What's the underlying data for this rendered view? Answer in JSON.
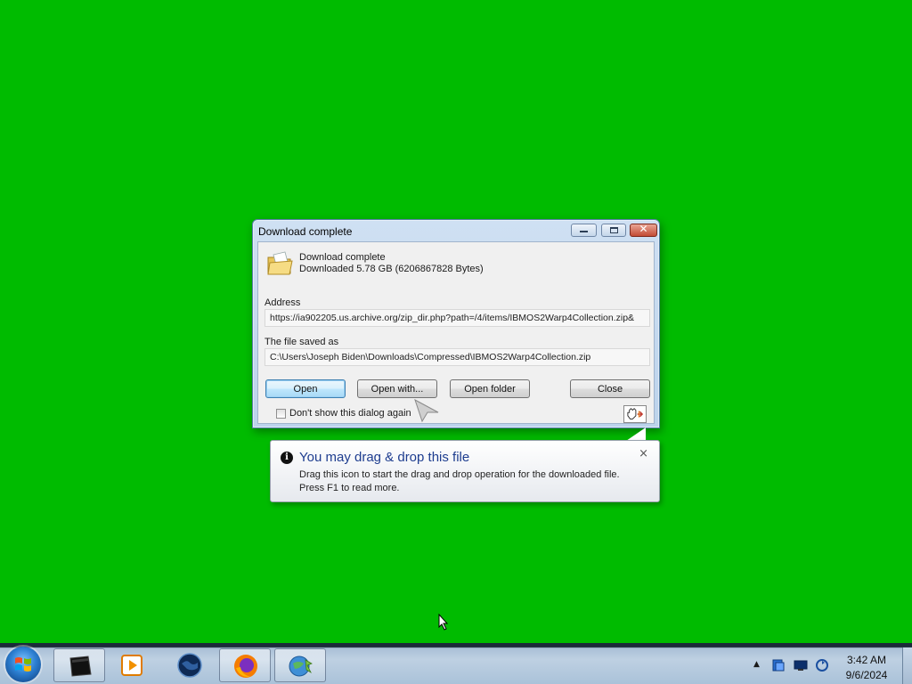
{
  "colors": {
    "desktop_background": "#00bb00",
    "balloon_title": "#1e3d8f"
  },
  "dialog": {
    "title": "Download complete",
    "status_line1": "Download complete",
    "status_line2": "Downloaded  5.78  GB (6206867828 Bytes)",
    "address_label": "Address",
    "address_value": "https://ia902205.us.archive.org/zip_dir.php?path=/4/items/IBMOS2Warp4Collection.zip&",
    "saved_label": "The file saved as",
    "saved_value": "C:\\Users\\Joseph Biden\\Downloads\\Compressed\\IBMOS2Warp4Collection.zip",
    "buttons": {
      "open": "Open",
      "open_with": "Open with...",
      "open_folder": "Open folder",
      "close": "Close"
    },
    "dont_show_label": "Don't show this dialog again",
    "dont_show_checked": false,
    "icons": {
      "file": "open-folder-icon",
      "drag": "drag-drop-handle-icon"
    }
  },
  "balloon": {
    "title": "You may drag & drop this file",
    "line1": "Drag this icon to start the drag and drop operation for the downloaded file.",
    "line2": "Press F1 to read more.",
    "close_glyph": "×"
  },
  "taskbar": {
    "apps": [
      {
        "name": "command-prompt-icon",
        "active": true
      },
      {
        "name": "media-player-icon",
        "active": false
      },
      {
        "name": "globe-browser-icon",
        "active": false
      },
      {
        "name": "firefox-icon",
        "active": true
      },
      {
        "name": "internet-download-manager-icon",
        "active": true
      }
    ],
    "tray_up_glyph": "▲",
    "clock_time": "3:42 AM",
    "clock_date": "9/6/2024"
  }
}
